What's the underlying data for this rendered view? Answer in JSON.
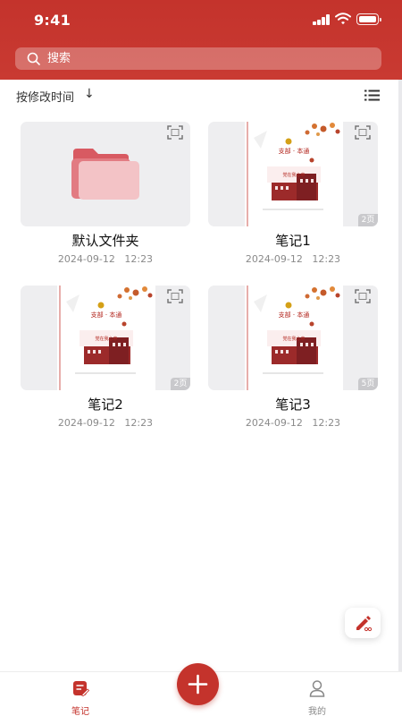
{
  "status_bar": {
    "time": "9:41"
  },
  "search": {
    "placeholder": "搜索"
  },
  "sort": {
    "label": "按修改时间",
    "arrow": "↓"
  },
  "colors": {
    "accent": "#c4332c",
    "background": "#ffffff",
    "thumb_bg": "#eeeef0",
    "folder": "#e8a2a6"
  },
  "items": [
    {
      "type": "folder",
      "title": "默认文件夹",
      "date": "2024-09-12",
      "time": "12:23"
    },
    {
      "type": "note",
      "title": "笔记1",
      "date": "2024-09-12",
      "time": "12:23",
      "pages": "2页"
    },
    {
      "type": "note",
      "title": "笔记2",
      "date": "2024-09-12",
      "time": "12:23",
      "pages": "2页"
    },
    {
      "type": "note",
      "title": "笔记3",
      "date": "2024-09-12",
      "time": "12:23",
      "pages": "5页"
    }
  ],
  "cover": {
    "line1": "支部 · 本通",
    "line2": "党在我心中"
  },
  "nav": {
    "notes_label": "笔记",
    "mine_label": "我的"
  },
  "icons": {
    "search": "search-icon",
    "list_view": "list-view-icon",
    "scan": "scan-icon",
    "folder": "folder-icon",
    "edit": "pen-icon",
    "add": "plus-icon",
    "notes_tab": "note-icon",
    "mine_tab": "person-icon"
  }
}
